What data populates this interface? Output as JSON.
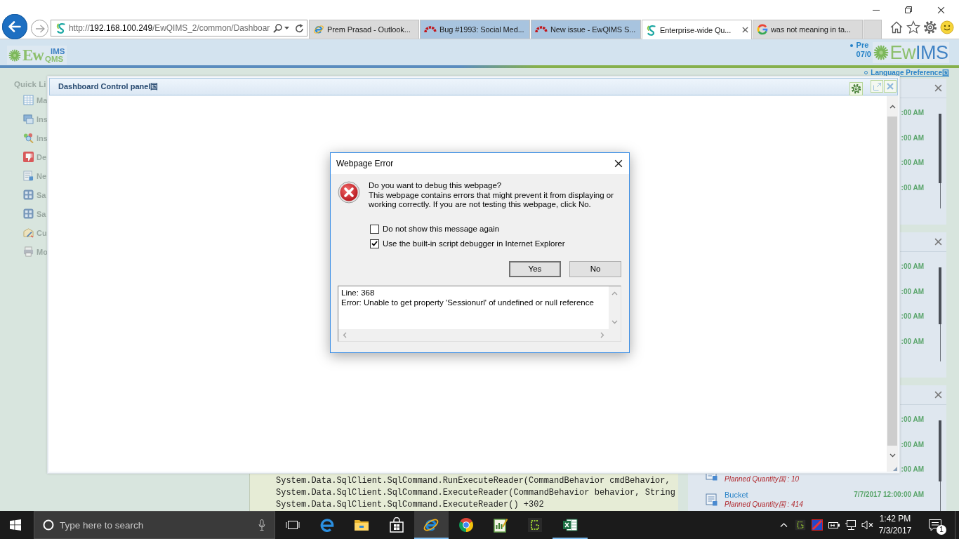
{
  "browser": {
    "address": {
      "scheme": "http://",
      "host": "192.168.100.249",
      "path": "/EwQIMS_2/common/Dashboar"
    },
    "tabs": [
      {
        "label": "Prem Prasad - Outlook...",
        "kind": "mail",
        "selected": false,
        "color": "#dadada"
      },
      {
        "label": "Bug #1993: Social Med...",
        "kind": "tracker",
        "selected": false,
        "color": "#a8c4df"
      },
      {
        "label": "New issue - EwQIMS S...",
        "kind": "tracker",
        "selected": false,
        "color": "#a8c4df"
      },
      {
        "label": "Enterprise-wide Qu...",
        "kind": "app",
        "selected": true,
        "color": "#ffffff"
      },
      {
        "label": "was not meaning in ta...",
        "kind": "search",
        "selected": false,
        "color": "#dadada"
      }
    ]
  },
  "header": {
    "logo": {
      "main": "Ew",
      "top": "IMS",
      "bottom": "QMS"
    },
    "user": [
      "Pre",
      "07/0"
    ],
    "brand": {
      "main": "Ew",
      "accent": "IMS"
    }
  },
  "sidebar": {
    "title": "Quick Li",
    "items": [
      {
        "label": "Ma",
        "kind": "table"
      },
      {
        "label": "Ins",
        "kind": "monitor"
      },
      {
        "label": "Ins",
        "kind": "magnifier"
      },
      {
        "label": "De",
        "kind": "thumbsdown"
      },
      {
        "label": "Ne",
        "kind": "document"
      },
      {
        "label": "Sa",
        "kind": "calculator"
      },
      {
        "label": "Sa",
        "kind": "calculator"
      },
      {
        "label": "Cu",
        "kind": "envelope"
      },
      {
        "label": "Mo",
        "kind": "printer"
      }
    ]
  },
  "error_page": {
    "code_lines": [
      "System.Data.SqlClient.SqlCommand.RunExecuteReader(CommandBehavior cmdBehavior,",
      "System.Data.SqlClient.SqlCommand.ExecuteReader(CommandBehavior behavior, String",
      "System.Data.SqlClient.SqlCommand.ExecuteReader() +302"
    ]
  },
  "right_column": {
    "language_link": "Language Preference国",
    "panels": [
      {
        "items": [
          {
            "time": ":00 AM"
          },
          {
            "time": ":00 AM"
          },
          {
            "time": ":00 AM"
          },
          {
            "time": ":00 AM"
          }
        ]
      },
      {
        "items": [
          {
            "time": ":00 AM"
          },
          {
            "time": ":00 AM"
          },
          {
            "time": ":00 AM"
          },
          {
            "time": ":00 AM"
          }
        ]
      },
      {
        "items": [
          {
            "time": ":00 AM"
          },
          {
            "time": ":00 AM"
          },
          {
            "time": ":00 AM",
            "detail": "Planned Quantity国 : 10"
          },
          {
            "name": "Bucket",
            "time": "7/7/2017 12:00:00 AM",
            "detail": "Planned Quantity国 : 414"
          }
        ]
      }
    ]
  },
  "dashboard": {
    "title": "Dashboard Control panel国"
  },
  "dialog": {
    "title": "Webpage Error",
    "question": "Do you want to debug this webpage?",
    "message": "This webpage contains errors that might prevent it from displaying or working correctly. If you are not testing this webpage, click No.",
    "options": [
      {
        "label": "Do not show this message again",
        "checked": false
      },
      {
        "label": "Use the built-in script debugger in Internet Explorer",
        "checked": true
      }
    ],
    "buttons": [
      {
        "label": "Yes",
        "default": true
      },
      {
        "label": "No",
        "default": false
      }
    ],
    "details": [
      "Line: 368",
      "Error: Unable to get property 'Sessionurl' of undefined or null reference"
    ]
  },
  "taskbar": {
    "search": {
      "placeholder": "Type here to search"
    },
    "apps": [
      {
        "kind": "taskview",
        "selected": false,
        "running": false
      },
      {
        "kind": "edge",
        "selected": false,
        "running": false
      },
      {
        "kind": "explorer",
        "selected": false,
        "running": false
      },
      {
        "kind": "store",
        "selected": false,
        "running": false
      },
      {
        "kind": "ie",
        "selected": true,
        "running": true
      },
      {
        "kind": "chrome",
        "selected": false,
        "running": false
      },
      {
        "kind": "chart",
        "selected": false,
        "running": false
      },
      {
        "kind": "grid",
        "selected": false,
        "running": false
      },
      {
        "kind": "excel",
        "selected": false,
        "running": true
      }
    ],
    "clock": {
      "time": "1:42 PM",
      "date": "7/3/2017"
    },
    "notifications": "1"
  }
}
